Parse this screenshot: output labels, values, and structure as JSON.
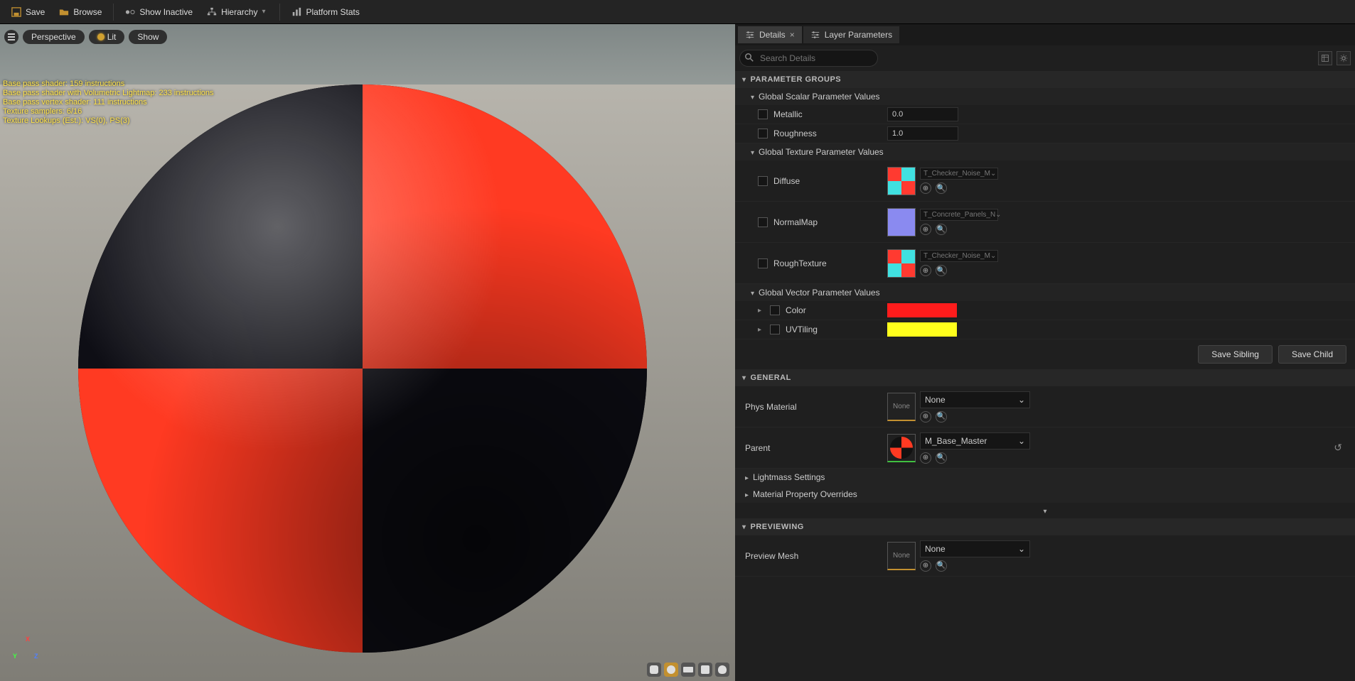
{
  "toolbar": {
    "save": "Save",
    "browse": "Browse",
    "show_inactive": "Show Inactive",
    "hierarchy": "Hierarchy",
    "platform_stats": "Platform Stats"
  },
  "viewport": {
    "menu": "≡",
    "perspective": "Perspective",
    "lit": "Lit",
    "show": "Show",
    "stats": [
      "Base pass shader: 159 instructions",
      "Base pass shader with Volumetric Lightmap: 233 instructions",
      "Base pass vertex shader: 111 instructions",
      "Texture samplers: 6/16",
      "Texture Lookups (Est.): VS(0), PS(3)"
    ]
  },
  "tabs": {
    "details": "Details",
    "layer_params": "Layer Parameters"
  },
  "search_placeholder": "Search Details",
  "sections": {
    "param_groups": "PARAMETER GROUPS",
    "general": "GENERAL",
    "previewing": "PREVIEWING"
  },
  "groups": {
    "scalar": "Global Scalar Parameter Values",
    "texture": "Global Texture Parameter Values",
    "vector": "Global Vector Parameter Values"
  },
  "scalar": {
    "metallic": {
      "label": "Metallic",
      "value": "0.0"
    },
    "roughness": {
      "label": "Roughness",
      "value": "1.0"
    }
  },
  "texture": {
    "diffuse": {
      "label": "Diffuse",
      "asset": "T_Checker_Noise_M"
    },
    "normal": {
      "label": "NormalMap",
      "asset": "T_Concrete_Panels_N"
    },
    "rough": {
      "label": "RoughTexture",
      "asset": "T_Checker_Noise_M"
    }
  },
  "vector": {
    "color": {
      "label": "Color",
      "hex": "#ff1c1c"
    },
    "uvtiling": {
      "label": "UVTiling",
      "hex": "#ffff1c"
    }
  },
  "buttons": {
    "save_sibling": "Save Sibling",
    "save_child": "Save Child"
  },
  "general": {
    "phys_material": {
      "label": "Phys Material",
      "value": "None",
      "thumb": "None"
    },
    "parent": {
      "label": "Parent",
      "value": "M_Base_Master"
    },
    "lightmass": "Lightmass Settings",
    "overrides": "Material Property Overrides"
  },
  "previewing": {
    "preview_mesh": {
      "label": "Preview Mesh",
      "value": "None",
      "thumb": "None"
    }
  }
}
